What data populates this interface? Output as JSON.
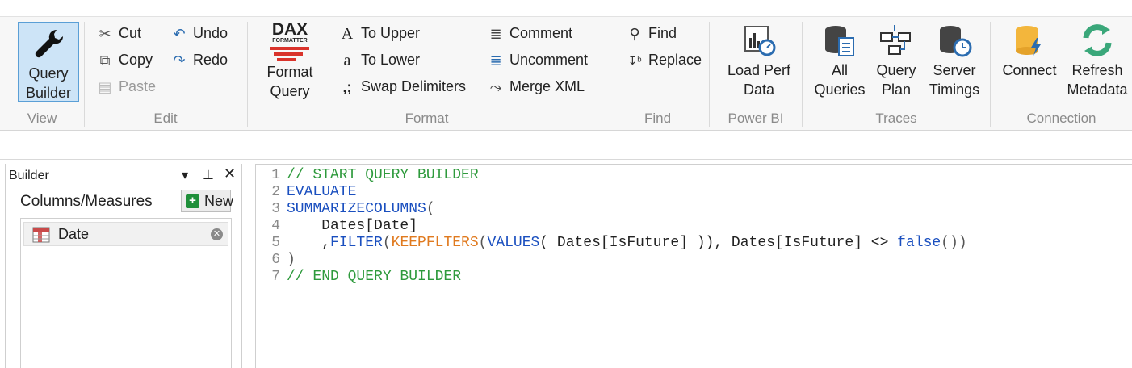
{
  "ribbon": {
    "view": {
      "label": "View",
      "query_builder": "Query\nBuilder"
    },
    "edit": {
      "label": "Edit",
      "cut": "Cut",
      "copy": "Copy",
      "paste": "Paste",
      "undo": "Undo",
      "redo": "Redo"
    },
    "format": {
      "label": "Format",
      "format_query": "Format\nQuery",
      "dax_logo": "DAX",
      "dax_logo_sub": "FORMATTER",
      "to_upper": "To Upper",
      "to_lower": "To Lower",
      "swap_delimiters": "Swap Delimiters",
      "comment": "Comment",
      "uncomment": "Uncomment",
      "merge_xml": "Merge XML"
    },
    "find": {
      "label": "Find",
      "find": "Find",
      "replace": "Replace"
    },
    "powerbi": {
      "label": "Power BI",
      "load_perf": "Load Perf\nData"
    },
    "traces": {
      "label": "Traces",
      "all_queries": "All\nQueries",
      "query_plan": "Query\nPlan",
      "server_timings": "Server\nTimings"
    },
    "connection": {
      "label": "Connection",
      "connect": "Connect",
      "refresh": "Refresh\nMetadata"
    }
  },
  "builder": {
    "title": "Builder",
    "columns_title": "Columns/Measures",
    "new_label": "New",
    "items": [
      {
        "label": "Date"
      }
    ]
  },
  "editor": {
    "lines": [
      {
        "num": "1",
        "tokens": [
          {
            "t": "// START QUERY BUILDER",
            "c": "c-comment"
          }
        ]
      },
      {
        "num": "2",
        "tokens": [
          {
            "t": "EVALUATE",
            "c": "c-kw"
          }
        ]
      },
      {
        "num": "3",
        "tokens": [
          {
            "t": "SUMMARIZECOLUMNS",
            "c": "c-fn"
          },
          {
            "t": "(",
            "c": "c-paren"
          }
        ]
      },
      {
        "num": "4",
        "tokens": [
          {
            "t": "    Dates[Date]",
            "c": "c-text"
          }
        ]
      },
      {
        "num": "5",
        "tokens": [
          {
            "t": "    ,",
            "c": "c-text"
          },
          {
            "t": "FILTER",
            "c": "c-fn"
          },
          {
            "t": "(",
            "c": "c-paren"
          },
          {
            "t": "KEEPFLTERS",
            "c": "c-fn2"
          },
          {
            "t": "(",
            "c": "c-paren"
          },
          {
            "t": "VALUES",
            "c": "c-fn"
          },
          {
            "t": "( Dates[IsFuture] )), Dates[IsFuture] <> ",
            "c": "c-text"
          },
          {
            "t": "false",
            "c": "c-fn"
          },
          {
            "t": "())",
            "c": "c-paren"
          }
        ]
      },
      {
        "num": "6",
        "tokens": [
          {
            "t": ")",
            "c": "c-paren"
          }
        ]
      },
      {
        "num": "7",
        "tokens": [
          {
            "t": "// END QUERY BUILDER",
            "c": "c-comment"
          }
        ]
      }
    ]
  },
  "colors": {
    "comment": "#2e9a3c",
    "keyword": "#1a4fbf",
    "function_alt": "#e07a1f",
    "active_button": "#cde4f7"
  }
}
